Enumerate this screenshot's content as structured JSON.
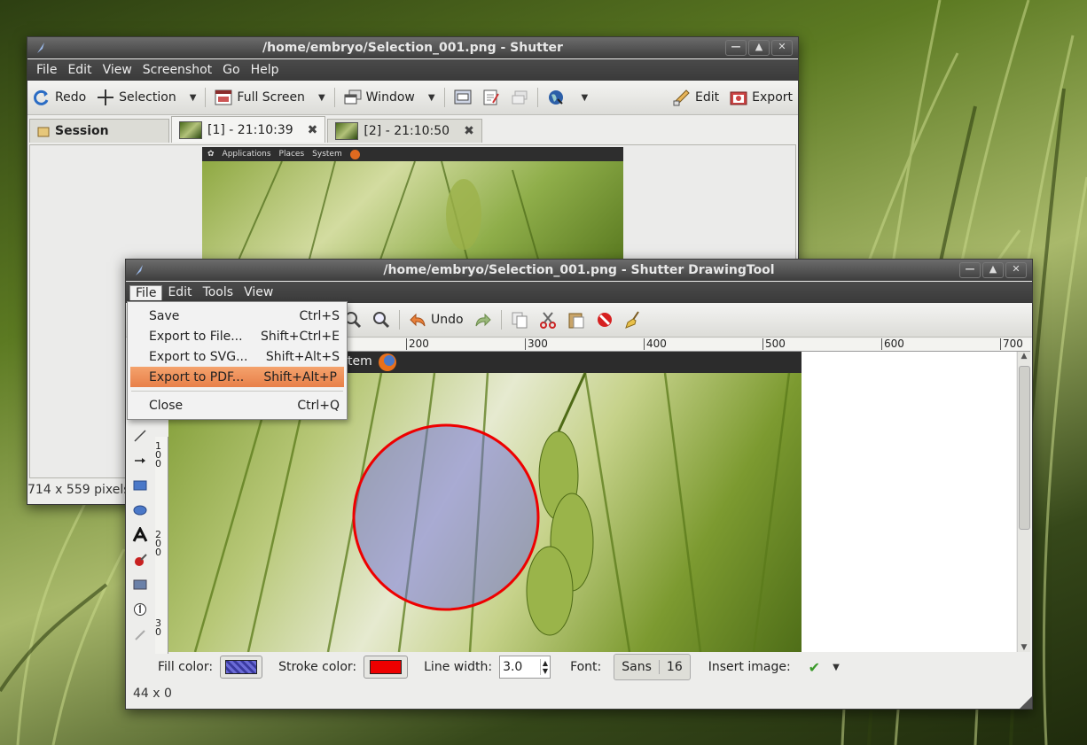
{
  "main_window": {
    "title": "/home/embryo/Selection_001.png - Shutter",
    "window_buttons": [
      "—",
      "▲",
      "✕"
    ],
    "menu": [
      "File",
      "Edit",
      "View",
      "Screenshot",
      "Go",
      "Help"
    ],
    "toolbar": {
      "redo": "Redo",
      "selection": "Selection",
      "full_screen": "Full Screen",
      "window": "Window",
      "edit": "Edit",
      "export": "Export"
    },
    "tabs": {
      "session": "Session",
      "tab1": "[1] - 21:10:39",
      "tab2": "[2] - 21:10:50"
    },
    "preview_panel_items": [
      "Applications",
      "Places",
      "System"
    ],
    "status": "714 x 559 pixels"
  },
  "drawing_window": {
    "title": "/home/embryo/Selection_001.png - Shutter DrawingTool",
    "window_buttons": [
      "—",
      "▲",
      "✕"
    ],
    "menu": [
      "File",
      "Edit",
      "Tools",
      "View"
    ],
    "toolbar": {
      "undo": "Undo"
    },
    "ruler_h": [
      "200",
      "300",
      "400",
      "500",
      "600",
      "700"
    ],
    "ruler_v": [
      "1 0 0",
      "2 0 0",
      "3 0"
    ],
    "canvas_text": "tem",
    "file_menu": [
      {
        "label": "Save",
        "shortcut": "Ctrl+S",
        "highlighted": false
      },
      {
        "label": "Export to File...",
        "shortcut": "Shift+Ctrl+E",
        "highlighted": false
      },
      {
        "label": "Export to SVG...",
        "shortcut": "Shift+Alt+S",
        "highlighted": false
      },
      {
        "label": "Export to PDF...",
        "shortcut": "Shift+Alt+P",
        "highlighted": true
      },
      {
        "label": "Close",
        "shortcut": "Ctrl+Q",
        "highlighted": false
      }
    ],
    "properties": {
      "fill_label": "Fill color:",
      "stroke_label": "Stroke color:",
      "line_width_label": "Line width:",
      "line_width_value": "3.0",
      "font_label": "Font:",
      "font_name": "Sans",
      "font_size": "16",
      "insert_image_label": "Insert image:"
    },
    "colors": {
      "fill": "#6b6bd6",
      "stroke": "#ee0000",
      "highlight": "#ec8a54"
    },
    "status": "44 x 0"
  }
}
